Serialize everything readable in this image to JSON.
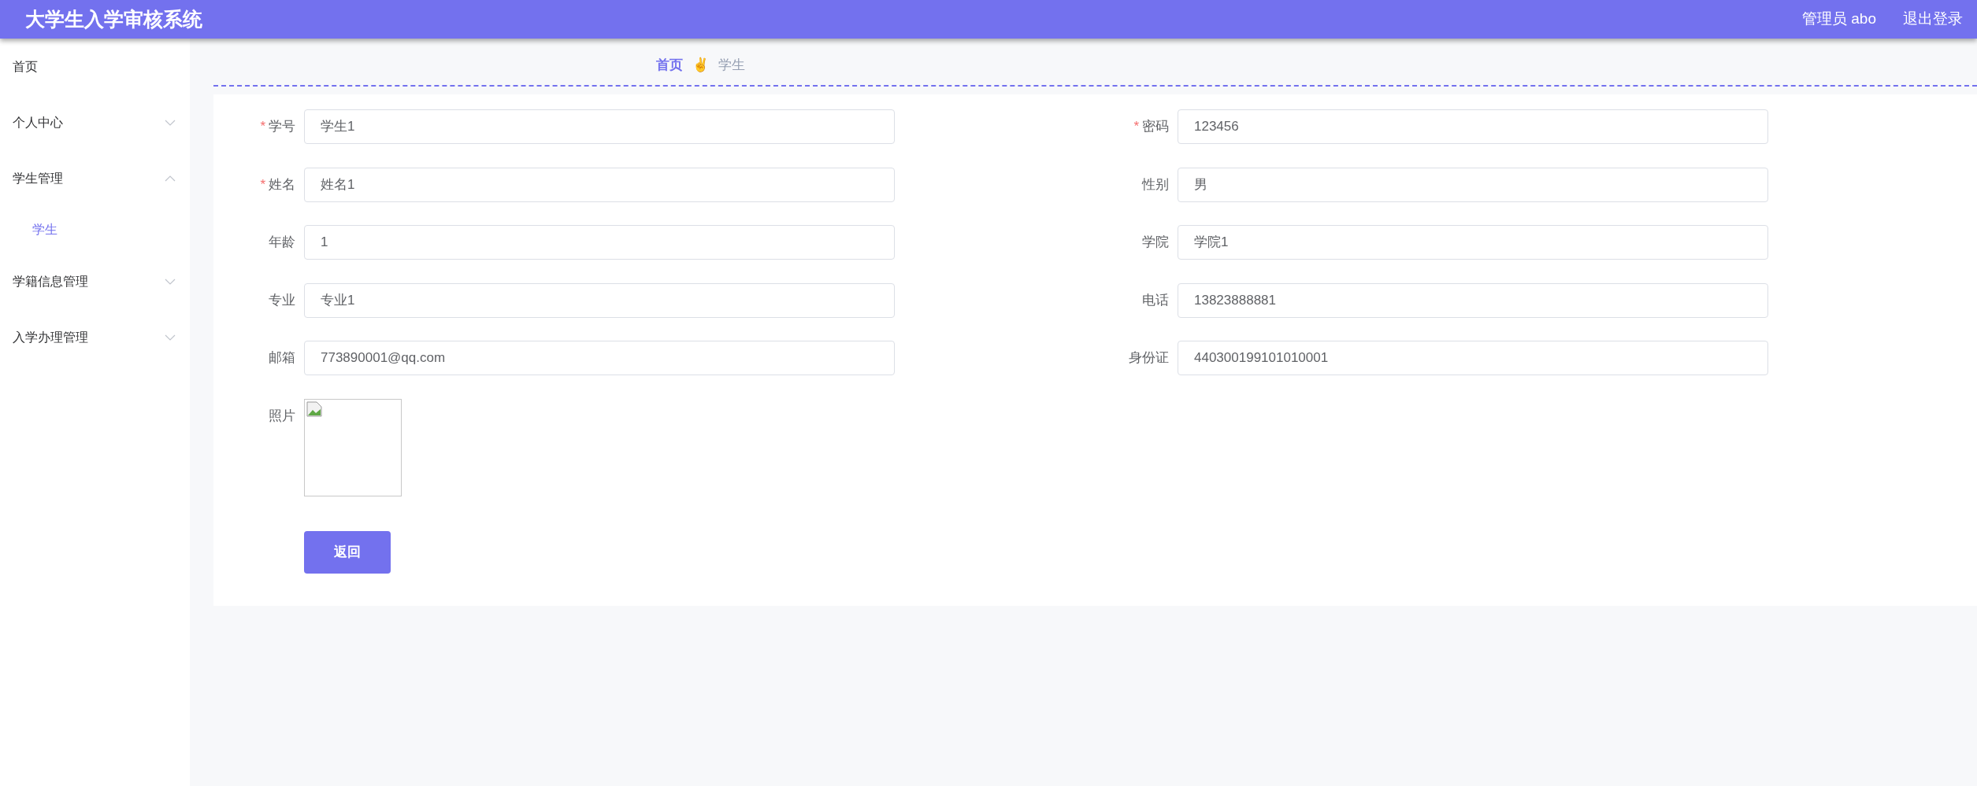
{
  "header": {
    "title": "大学生入学审核系统",
    "user": "管理员 abo",
    "logout": "退出登录"
  },
  "sidebar": {
    "items": [
      {
        "label": "首页",
        "kind": "link",
        "selected": false
      },
      {
        "label": "个人中心",
        "kind": "submenu",
        "expanded": false
      },
      {
        "label": "学生管理",
        "kind": "submenu",
        "expanded": true,
        "children": [
          {
            "label": "学生",
            "selected": true
          }
        ]
      },
      {
        "label": "学籍信息管理",
        "kind": "submenu",
        "expanded": false
      },
      {
        "label": "入学办理管理",
        "kind": "submenu",
        "expanded": false
      }
    ]
  },
  "breadcrumb": {
    "items": [
      "首页",
      "学生"
    ],
    "separator": "✌"
  },
  "form": {
    "fields": [
      {
        "label": "学号",
        "required": true,
        "kind": "text",
        "value": "学生1"
      },
      {
        "label": "密码",
        "required": true,
        "kind": "text",
        "value": "123456"
      },
      {
        "label": "姓名",
        "required": true,
        "kind": "text",
        "value": "姓名1"
      },
      {
        "label": "性别",
        "required": false,
        "kind": "text",
        "value": "男"
      },
      {
        "label": "年龄",
        "required": false,
        "kind": "text",
        "value": "1"
      },
      {
        "label": "学院",
        "required": false,
        "kind": "text",
        "value": "学院1"
      },
      {
        "label": "专业",
        "required": false,
        "kind": "text",
        "value": "专业1"
      },
      {
        "label": "电话",
        "required": false,
        "kind": "text",
        "value": "13823888881"
      },
      {
        "label": "邮箱",
        "required": false,
        "kind": "text",
        "value": "773890001@qq.com"
      },
      {
        "label": "身份证",
        "required": false,
        "kind": "text",
        "value": "440300199101010001"
      },
      {
        "label": "照片",
        "required": false,
        "kind": "image"
      }
    ],
    "required_mark": "*",
    "button": "返回"
  }
}
